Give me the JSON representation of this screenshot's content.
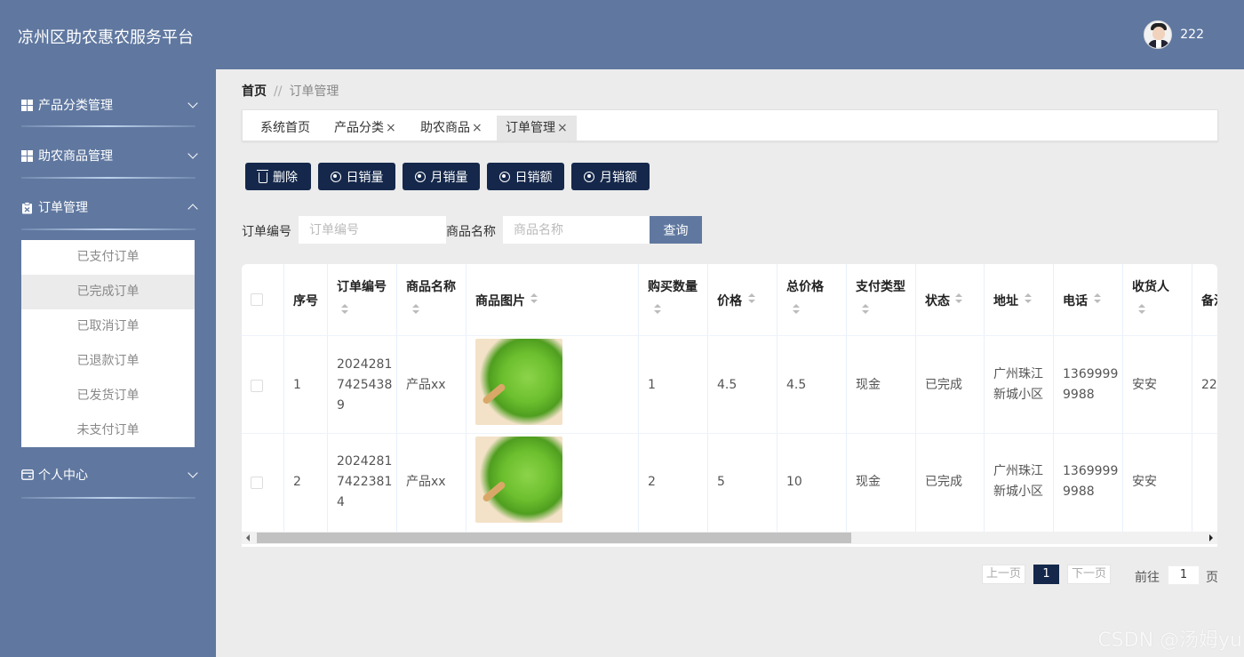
{
  "app": {
    "title": "凉州区助农惠农服务平台",
    "username": "222"
  },
  "sidebar": {
    "menus": [
      {
        "label": "产品分类管理"
      },
      {
        "label": "助农商品管理"
      },
      {
        "label": "订单管理"
      },
      {
        "label": "个人中心"
      }
    ],
    "submenu": [
      {
        "label": "已支付订单"
      },
      {
        "label": "已完成订单"
      },
      {
        "label": "已取消订单"
      },
      {
        "label": "已退款订单"
      },
      {
        "label": "已发货订单"
      },
      {
        "label": "未支付订单"
      }
    ]
  },
  "breadcrumb": {
    "home": "首页",
    "separator": "//",
    "current": "订单管理"
  },
  "tabs": [
    {
      "label": "系统首页"
    },
    {
      "label": "产品分类"
    },
    {
      "label": "助农商品"
    },
    {
      "label": "订单管理"
    }
  ],
  "tab_close": "×",
  "toolbar": {
    "delete": "删除",
    "daily_sales_qty": "日销量",
    "monthly_sales_qty": "月销量",
    "daily_sales_amt": "日销额",
    "monthly_sales_amt": "月销额"
  },
  "search": {
    "order_no_label": "订单编号",
    "order_no_placeholder": "订单编号",
    "product_name_label": "商品名称",
    "product_name_placeholder": "商品名称",
    "query": "查询"
  },
  "table": {
    "headers": {
      "index": "序号",
      "order_no": "订单编号",
      "product_name": "商品名称",
      "product_image": "商品图片",
      "quantity": "购买数量",
      "price": "价格",
      "total": "总价格",
      "pay_type": "支付类型",
      "status": "状态",
      "address": "地址",
      "phone": "电话",
      "receiver": "收货人",
      "remark": "备注"
    },
    "rows": [
      {
        "index": "1",
        "order_no_1": "2024281",
        "order_no_2": "7425438",
        "order_no_3": "9",
        "product_name": "产品xx",
        "quantity": "1",
        "price": "4.5",
        "total": "4.5",
        "pay_type": "现金",
        "status": "已完成",
        "address_1": "广州珠江",
        "address_2": "新城小区",
        "phone_1": "1369999",
        "phone_2": "9988",
        "receiver": "安安",
        "remark": "22"
      },
      {
        "index": "2",
        "order_no_1": "2024281",
        "order_no_2": "7422381",
        "order_no_3": "4",
        "product_name": "产品xx",
        "quantity": "2",
        "price": "5",
        "total": "10",
        "pay_type": "现金",
        "status": "已完成",
        "address_1": "广州珠江",
        "address_2": "新城小区",
        "phone_1": "1369999",
        "phone_2": "9988",
        "receiver": "安安",
        "remark": ""
      }
    ]
  },
  "pagination": {
    "prev": "上一页",
    "current": "1",
    "next": "下一页",
    "goto": "前往",
    "goto_value": "1",
    "page_unit": "页"
  },
  "watermark": "CSDN @汤姆yu"
}
